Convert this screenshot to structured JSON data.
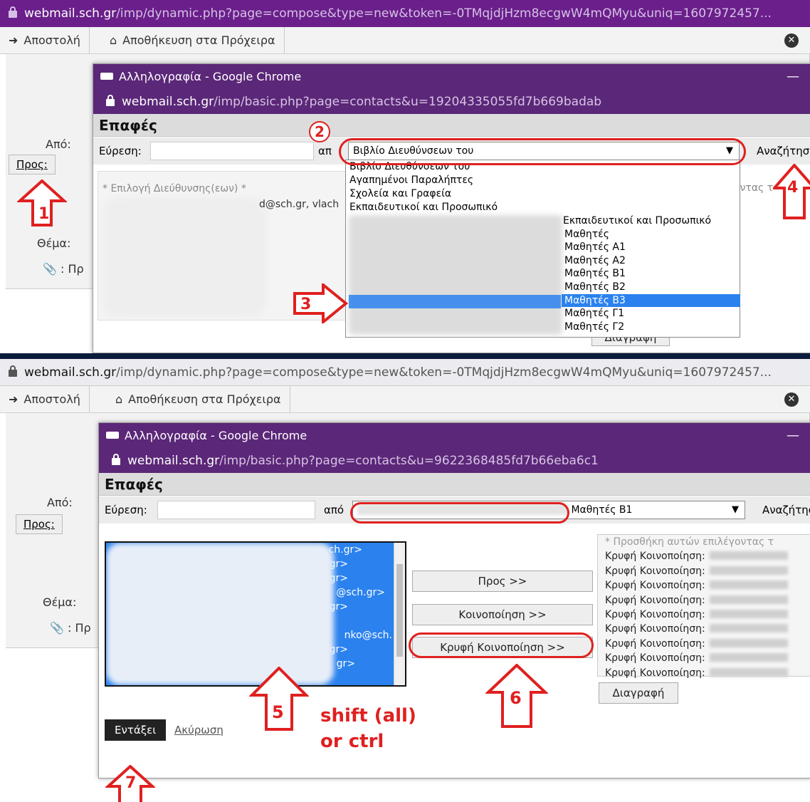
{
  "top": {
    "url_host": "webmail.sch.gr",
    "url_path": "/imp/dynamic.php?page=compose&type=new&token=-0TMqjdjHzm8ecgwW4mQMyu&uniq=1607972457...",
    "toolbar": {
      "send": "Αποστολή",
      "save_draft": "Αποθήκευση στα Πρόχειρα"
    },
    "compose": {
      "from": "Από:",
      "to": "Προς:",
      "subject": "Θέμα:",
      "attach": "Πρ"
    },
    "popup": {
      "title": "Αλληλογραφία - Google Chrome",
      "url_host": "webmail.sch.gr",
      "url_path": "/imp/basic.php?page=contacts&u=19204335055fd7b669badab",
      "header": "Επαφές",
      "find_label": "Εύρεση:",
      "from_label": "απ",
      "search_button": "Αναζήτησ",
      "select_value": "Βιβλίο Διευθύνσεων του",
      "address_pick_label": "* Επιλογή Διεύθυνσης(εων) *",
      "address_partial": "d@sch.gr, vlach",
      "tail_text": "οντας τ",
      "dropdown_options": [
        "Βιβλίο Διευθύνσεων του",
        "Αγαπημένοι Παραλήπτες",
        "Σχολεία και Γραφεία",
        "Εκπαιδευτικοί και Προσωπικό"
      ],
      "dropdown_groups": [
        "Εκπαιδευτικοί και Προσωπικό",
        "Μαθητές",
        "Μαθητές Α1",
        "Μαθητές Α2",
        "Μαθητές Β1",
        "Μαθητές Β2",
        "Μαθητές Β3",
        "Μαθητές Γ1",
        "Μαθητές Γ2"
      ],
      "delete_button": "Διαγραφή"
    },
    "annotations": [
      "1",
      "2",
      "3",
      "4"
    ]
  },
  "bottom": {
    "url_host": "webmail.sch.gr",
    "url_path": "/imp/dynamic.php?page=compose&type=new&token=-0TMqjdjHzm8ecgwW4mQMyu&uniq=1607972457...",
    "toolbar": {
      "send": "Αποστολή",
      "save_draft": "Αποθήκευση στα Πρόχειρα"
    },
    "compose": {
      "from": "Από:",
      "to": "Προς:",
      "subject": "Θέμα:",
      "attach": "Πρ"
    },
    "popup": {
      "title": "Αλληλογραφία - Google Chrome",
      "url_host": "webmail.sch.gr",
      "url_path": "/imp/basic.php?page=contacts&u=9622368485fd7b66eba6c1",
      "header": "Επαφές",
      "find_label": "Εύρεση:",
      "from_label": "από",
      "search_button": "Αναζήτησ",
      "select_value": "Μαθητές Β1",
      "add_label": "* Προσθήκη αυτών επιλέγοντας τ",
      "to_button": "Προς >>",
      "cc_button": "Κοινοποίηση >>",
      "bcc_button": "Κρυφή Κοινοποίηση >>",
      "recipient_prefix": "Κρυφή Κοινοποίηση:",
      "recipient_count": 9,
      "delete_button": "Διαγραφή",
      "ok_button": "Εντάξει",
      "cancel_link": "Ακύρωση",
      "listbox_emails": [
        "ch.gr>",
        "h.gr>",
        "h.gr>",
        "@sch.gr>",
        "@sch.gr>",
        "",
        "nko@sch.",
        "gr>",
        "gr>"
      ]
    },
    "annotations": [
      "5",
      "6",
      "7"
    ],
    "hint_line1": "shift (all)",
    "hint_line2": "or ctrl"
  }
}
